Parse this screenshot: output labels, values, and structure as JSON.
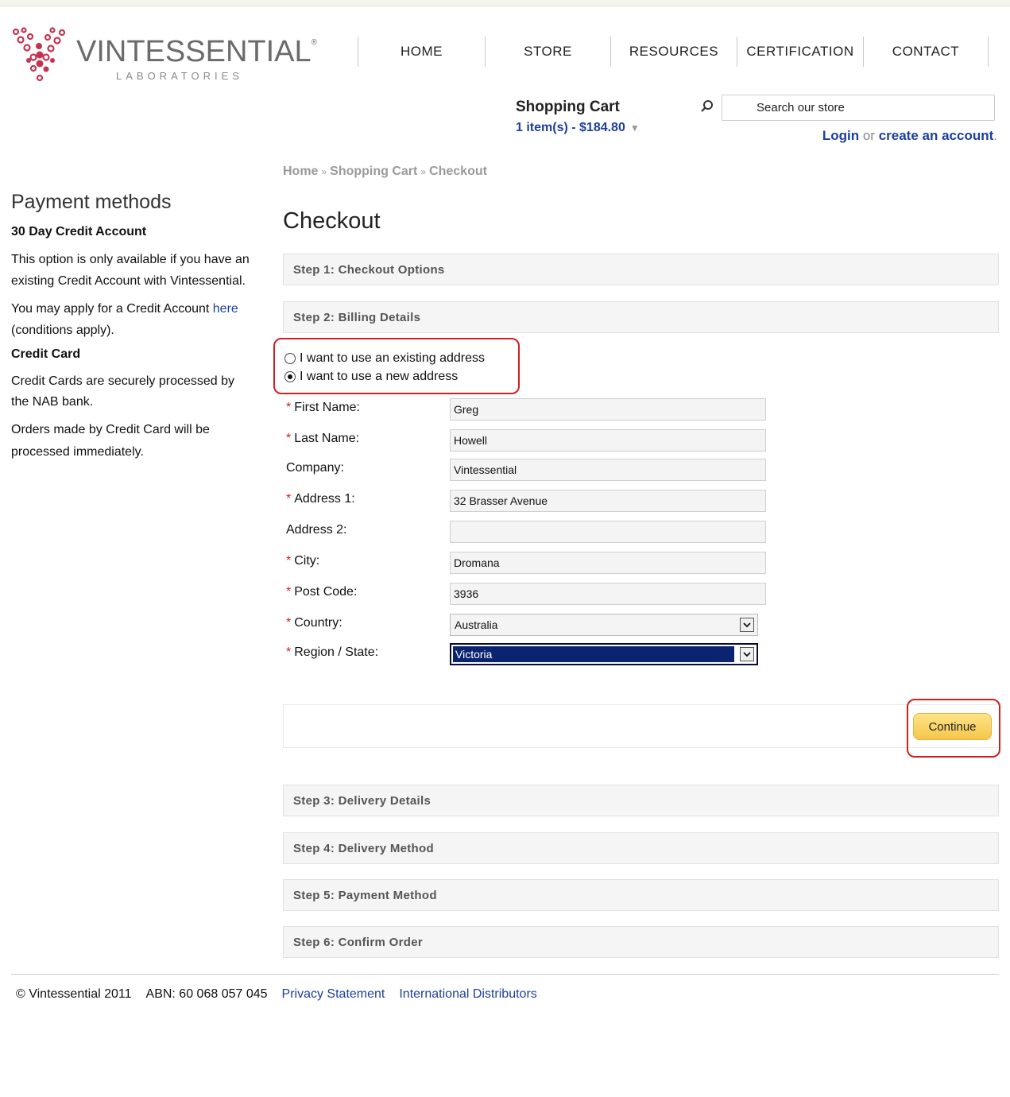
{
  "brand": {
    "name": "VINTESSENTIAL",
    "registered": "®",
    "subtitle": "LABORATORIES",
    "accent": "#c4334f"
  },
  "nav": [
    "HOME",
    "STORE",
    "RESOURCES",
    "CERTIFICATION",
    "CONTACT"
  ],
  "cart": {
    "title": "Shopping Cart",
    "summary": "1 item(s) - $184.80"
  },
  "search": {
    "placeholder": "Search our store"
  },
  "auth": {
    "login": "Login",
    "or": "or",
    "create": "create an account",
    "period": "."
  },
  "breadcrumb": [
    "Home",
    "Shopping Cart",
    "Checkout"
  ],
  "sidebar": {
    "title": "Payment methods",
    "credit_heading": "30 Day Credit Account",
    "credit_p1": "This option is only available if you have an existing Credit Account with Vintessential.",
    "credit_p2_pre": "You may apply for a Credit Account",
    "credit_p2_link": "here",
    "credit_p2_post": "(conditions apply).",
    "card_heading": "Credit Card",
    "card_p1": "Credit Cards are securely processed by the NAB bank.",
    "card_p2": "Orders made by Credit Card will be processed immediately."
  },
  "checkout": {
    "title": "Checkout",
    "steps": [
      "Step 1: Checkout Options",
      "Step 2: Billing Details",
      "Step 3: Delivery Details",
      "Step 4: Delivery Method",
      "Step 5: Payment Method",
      "Step 6: Confirm Order"
    ],
    "address_options": [
      {
        "label": "I want to use an existing address",
        "selected": false
      },
      {
        "label": "I want to use a new address",
        "selected": true
      }
    ],
    "required_mark": "*",
    "fields": {
      "first_name": {
        "label": "First Name:",
        "value": "Greg"
      },
      "last_name": {
        "label": "Last Name:",
        "value": "Howell"
      },
      "company": {
        "label": "Company:",
        "value": "Vintessential"
      },
      "address1": {
        "label": "Address 1:",
        "value": "32 Brasser Avenue"
      },
      "address2": {
        "label": "Address 2:",
        "value": ""
      },
      "city": {
        "label": "City:",
        "value": "Dromana"
      },
      "postcode": {
        "label": "Post Code:",
        "value": "3936"
      },
      "country": {
        "label": "Country:",
        "value": "Australia"
      },
      "region": {
        "label": "Region / State:",
        "value": "Victoria"
      }
    },
    "continue": "Continue"
  },
  "footer": {
    "copyright": "© Vintessential 2011",
    "abn": "ABN: 60 068 057 045",
    "privacy": "Privacy Statement",
    "distributors": "International Distributors"
  }
}
